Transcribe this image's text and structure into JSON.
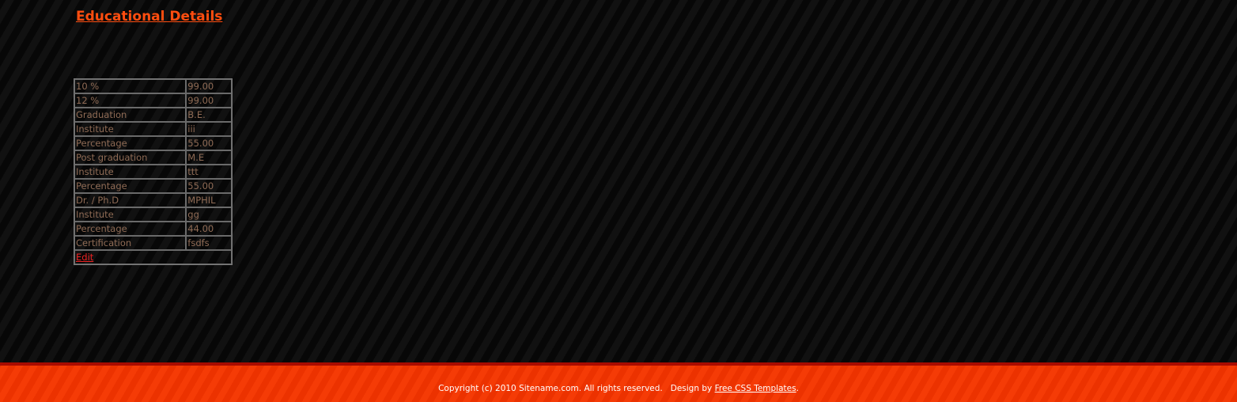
{
  "page": {
    "title": "Educational Details"
  },
  "education": {
    "rows": [
      {
        "label": "10 %",
        "value": "99.00"
      },
      {
        "label": "12 %",
        "value": "99.00"
      },
      {
        "label": "Graduation",
        "value": "B.E."
      },
      {
        "label": "Institute",
        "value": "iii"
      },
      {
        "label": "Percentage",
        "value": "55.00"
      },
      {
        "label": "Post graduation",
        "value": "M.E"
      },
      {
        "label": "Institute",
        "value": "ttt"
      },
      {
        "label": "Percentage",
        "value": "55.00"
      },
      {
        "label": "Dr. / Ph.D",
        "value": "MPHIL"
      },
      {
        "label": "Institute",
        "value": "gg"
      },
      {
        "label": "Percentage",
        "value": "44.00"
      },
      {
        "label": "Certification",
        "value": "fsdfs"
      }
    ],
    "edit_label": "Edit"
  },
  "footer": {
    "copyright": "Copyright (c) 2010 Sitename.com. All rights reserved.",
    "design_by": "Design by",
    "designer_link": "Free CSS Templates",
    "end_punct": "."
  },
  "colors": {
    "title": "#ff4d0f",
    "text": "#8f6b55",
    "link": "#ee2222",
    "footer_bg": "#ee3300",
    "footer_border": "#a80b00"
  }
}
